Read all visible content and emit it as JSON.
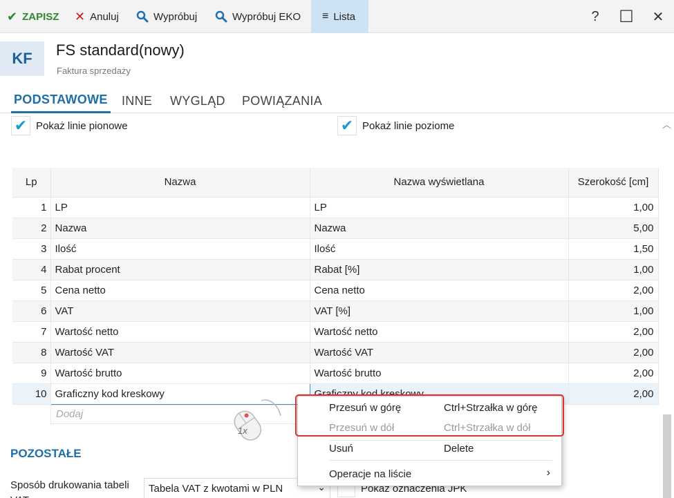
{
  "toolbar": {
    "save_label": "ZAPISZ",
    "cancel_label": "Anuluj",
    "try_label": "Wypróbuj",
    "try_eko_label": "Wypróbuj EKO",
    "list_label": "Lista",
    "help_glyph": "?",
    "maximize_glyph": "☐",
    "close_glyph": "✕"
  },
  "header": {
    "badge": "KF",
    "title": "FS standard(nowy)",
    "subtitle": "Faktura sprzedaży"
  },
  "tabs": [
    "PODSTAWOWE",
    "INNE",
    "WYGLĄD",
    "POWIĄZANIA"
  ],
  "options": {
    "vertical_lines": {
      "label": "Pokaż linie pionowe",
      "checked": true
    },
    "horizontal_lines": {
      "label": "Pokaż linie poziome",
      "checked": true
    }
  },
  "grid": {
    "columns": [
      "Lp",
      "Nazwa",
      "Nazwa wyświetlana",
      "Szerokość [cm]"
    ],
    "rows": [
      {
        "lp": "1",
        "name": "LP",
        "display": "LP",
        "width": "1,00"
      },
      {
        "lp": "2",
        "name": "Nazwa",
        "display": "Nazwa",
        "width": "5,00"
      },
      {
        "lp": "3",
        "name": "Ilość",
        "display": "Ilość",
        "width": "1,50"
      },
      {
        "lp": "4",
        "name": "Rabat procent",
        "display": "Rabat [%]",
        "width": "1,00"
      },
      {
        "lp": "5",
        "name": "Cena netto",
        "display": "Cena netto",
        "width": "2,00"
      },
      {
        "lp": "6",
        "name": "VAT",
        "display": "VAT [%]",
        "width": "1,00"
      },
      {
        "lp": "7",
        "name": "Wartość netto",
        "display": "Wartość netto",
        "width": "2,00"
      },
      {
        "lp": "8",
        "name": "Wartość VAT",
        "display": "Wartość VAT",
        "width": "2,00"
      },
      {
        "lp": "9",
        "name": "Wartość brutto",
        "display": "Wartość brutto",
        "width": "2,00"
      },
      {
        "lp": "10",
        "name": "Graficzny kod kreskowy",
        "display": "Graficzny kod kreskowy",
        "width": "2,00"
      }
    ],
    "add_placeholder": "Dodaj"
  },
  "mouse_hint": "1x",
  "section": {
    "title": "POZOSTAŁE",
    "vat_label": "Sposób drukowania tabeli VAT:",
    "vat_value": "Tabela VAT z kwotami w PLN",
    "jpk_label": "Pokaż oznaczenia JPK"
  },
  "context_menu": {
    "items": [
      {
        "label": "Przesuń w górę",
        "shortcut": "Ctrl+Strzałka w górę",
        "disabled": false
      },
      {
        "label": "Przesuń w dół",
        "shortcut": "Ctrl+Strzałka w dół",
        "disabled": true
      },
      {
        "label": "Usuń",
        "shortcut": "Delete",
        "disabled": false
      },
      {
        "label": "Operacje na liście",
        "shortcut": "",
        "disabled": false
      }
    ],
    "submenu_arrow": "›"
  },
  "colors": {
    "accent": "#1e6fa8",
    "save_green": "#2c8a2c",
    "cancel_red": "#d0191e",
    "highlight_red": "#e03232",
    "list_active_bg": "#cde3f3"
  }
}
